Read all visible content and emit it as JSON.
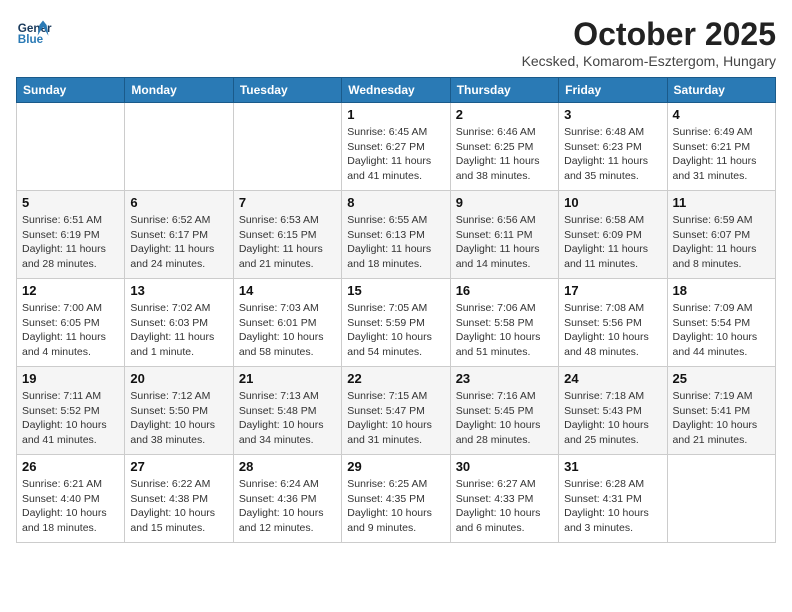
{
  "logo": {
    "line1": "General",
    "line2": "Blue"
  },
  "title": "October 2025",
  "subtitle": "Kecsked, Komarom-Esztergom, Hungary",
  "days_of_week": [
    "Sunday",
    "Monday",
    "Tuesday",
    "Wednesday",
    "Thursday",
    "Friday",
    "Saturday"
  ],
  "weeks": [
    [
      {
        "day": "",
        "info": ""
      },
      {
        "day": "",
        "info": ""
      },
      {
        "day": "",
        "info": ""
      },
      {
        "day": "1",
        "info": "Sunrise: 6:45 AM\nSunset: 6:27 PM\nDaylight: 11 hours\nand 41 minutes."
      },
      {
        "day": "2",
        "info": "Sunrise: 6:46 AM\nSunset: 6:25 PM\nDaylight: 11 hours\nand 38 minutes."
      },
      {
        "day": "3",
        "info": "Sunrise: 6:48 AM\nSunset: 6:23 PM\nDaylight: 11 hours\nand 35 minutes."
      },
      {
        "day": "4",
        "info": "Sunrise: 6:49 AM\nSunset: 6:21 PM\nDaylight: 11 hours\nand 31 minutes."
      }
    ],
    [
      {
        "day": "5",
        "info": "Sunrise: 6:51 AM\nSunset: 6:19 PM\nDaylight: 11 hours\nand 28 minutes."
      },
      {
        "day": "6",
        "info": "Sunrise: 6:52 AM\nSunset: 6:17 PM\nDaylight: 11 hours\nand 24 minutes."
      },
      {
        "day": "7",
        "info": "Sunrise: 6:53 AM\nSunset: 6:15 PM\nDaylight: 11 hours\nand 21 minutes."
      },
      {
        "day": "8",
        "info": "Sunrise: 6:55 AM\nSunset: 6:13 PM\nDaylight: 11 hours\nand 18 minutes."
      },
      {
        "day": "9",
        "info": "Sunrise: 6:56 AM\nSunset: 6:11 PM\nDaylight: 11 hours\nand 14 minutes."
      },
      {
        "day": "10",
        "info": "Sunrise: 6:58 AM\nSunset: 6:09 PM\nDaylight: 11 hours\nand 11 minutes."
      },
      {
        "day": "11",
        "info": "Sunrise: 6:59 AM\nSunset: 6:07 PM\nDaylight: 11 hours\nand 8 minutes."
      }
    ],
    [
      {
        "day": "12",
        "info": "Sunrise: 7:00 AM\nSunset: 6:05 PM\nDaylight: 11 hours\nand 4 minutes."
      },
      {
        "day": "13",
        "info": "Sunrise: 7:02 AM\nSunset: 6:03 PM\nDaylight: 11 hours\nand 1 minute."
      },
      {
        "day": "14",
        "info": "Sunrise: 7:03 AM\nSunset: 6:01 PM\nDaylight: 10 hours\nand 58 minutes."
      },
      {
        "day": "15",
        "info": "Sunrise: 7:05 AM\nSunset: 5:59 PM\nDaylight: 10 hours\nand 54 minutes."
      },
      {
        "day": "16",
        "info": "Sunrise: 7:06 AM\nSunset: 5:58 PM\nDaylight: 10 hours\nand 51 minutes."
      },
      {
        "day": "17",
        "info": "Sunrise: 7:08 AM\nSunset: 5:56 PM\nDaylight: 10 hours\nand 48 minutes."
      },
      {
        "day": "18",
        "info": "Sunrise: 7:09 AM\nSunset: 5:54 PM\nDaylight: 10 hours\nand 44 minutes."
      }
    ],
    [
      {
        "day": "19",
        "info": "Sunrise: 7:11 AM\nSunset: 5:52 PM\nDaylight: 10 hours\nand 41 minutes."
      },
      {
        "day": "20",
        "info": "Sunrise: 7:12 AM\nSunset: 5:50 PM\nDaylight: 10 hours\nand 38 minutes."
      },
      {
        "day": "21",
        "info": "Sunrise: 7:13 AM\nSunset: 5:48 PM\nDaylight: 10 hours\nand 34 minutes."
      },
      {
        "day": "22",
        "info": "Sunrise: 7:15 AM\nSunset: 5:47 PM\nDaylight: 10 hours\nand 31 minutes."
      },
      {
        "day": "23",
        "info": "Sunrise: 7:16 AM\nSunset: 5:45 PM\nDaylight: 10 hours\nand 28 minutes."
      },
      {
        "day": "24",
        "info": "Sunrise: 7:18 AM\nSunset: 5:43 PM\nDaylight: 10 hours\nand 25 minutes."
      },
      {
        "day": "25",
        "info": "Sunrise: 7:19 AM\nSunset: 5:41 PM\nDaylight: 10 hours\nand 21 minutes."
      }
    ],
    [
      {
        "day": "26",
        "info": "Sunrise: 6:21 AM\nSunset: 4:40 PM\nDaylight: 10 hours\nand 18 minutes."
      },
      {
        "day": "27",
        "info": "Sunrise: 6:22 AM\nSunset: 4:38 PM\nDaylight: 10 hours\nand 15 minutes."
      },
      {
        "day": "28",
        "info": "Sunrise: 6:24 AM\nSunset: 4:36 PM\nDaylight: 10 hours\nand 12 minutes."
      },
      {
        "day": "29",
        "info": "Sunrise: 6:25 AM\nSunset: 4:35 PM\nDaylight: 10 hours\nand 9 minutes."
      },
      {
        "day": "30",
        "info": "Sunrise: 6:27 AM\nSunset: 4:33 PM\nDaylight: 10 hours\nand 6 minutes."
      },
      {
        "day": "31",
        "info": "Sunrise: 6:28 AM\nSunset: 4:31 PM\nDaylight: 10 hours\nand 3 minutes."
      },
      {
        "day": "",
        "info": ""
      }
    ]
  ]
}
